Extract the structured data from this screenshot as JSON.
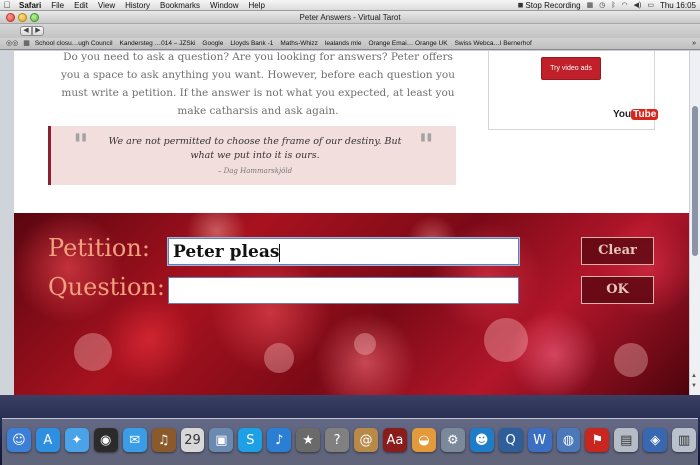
{
  "menubar": {
    "apple": "",
    "items": [
      "Safari",
      "File",
      "Edit",
      "View",
      "History",
      "Bookmarks",
      "Window",
      "Help"
    ],
    "stop_recording": "Stop Recording",
    "clock": "Thu 16:05"
  },
  "window": {
    "title": "Peter Answers - Virtual Tarot"
  },
  "bookmarks": [
    "School closu…ugh Council",
    "Kandersteg …014 – JZSki",
    "Google",
    "Lloyds Bank -1",
    "Maths-Whizz",
    "lealands mle",
    "Orange Emai… Orange UK",
    "Swiss Webca…l Bernerhof"
  ],
  "page": {
    "intro": "Do you need to ask a question? Are you looking for answers? Peter offers you a space to ask anything you want. However, before each question you must write a petition. If the answer is not what you expected, at least you make catharsis and ask again.",
    "quote": {
      "text": "We are not permitted to choose the frame of our destiny. But what we put into it is ours.",
      "author": "– Dag Hammarskjöld"
    },
    "ad": {
      "button": "Try video ads",
      "logo_you": "You",
      "logo_tube": "Tube"
    },
    "form": {
      "petition_label": "Petition:",
      "question_label": "Question:",
      "petition_value": "Peter pleas",
      "question_value": "",
      "clear_button": "Clear",
      "ok_button": "OK"
    }
  },
  "dock": [
    {
      "name": "finder-icon",
      "glyph": "☺",
      "color": "#3c7fd6"
    },
    {
      "name": "app-store-icon",
      "glyph": "A",
      "color": "#2e8fe0"
    },
    {
      "name": "safari-icon",
      "glyph": "✦",
      "color": "#4aa3e8"
    },
    {
      "name": "dashboard-icon",
      "glyph": "◉",
      "color": "#2b2b2b"
    },
    {
      "name": "ichat-icon",
      "glyph": "✉",
      "color": "#3a9de6"
    },
    {
      "name": "garageband-icon",
      "glyph": "♫",
      "color": "#8a5a2b"
    },
    {
      "name": "ical-icon",
      "glyph": "29",
      "color": "#d8d8d8"
    },
    {
      "name": "iphoto-icon",
      "glyph": "▣",
      "color": "#6b8ab0"
    },
    {
      "name": "skype-icon",
      "glyph": "S",
      "color": "#1ea0e6"
    },
    {
      "name": "itunes-icon",
      "glyph": "♪",
      "color": "#2a7fd4"
    },
    {
      "name": "imovie-icon",
      "glyph": "★",
      "color": "#6a6a6a"
    },
    {
      "name": "help-icon",
      "glyph": "?",
      "color": "#808080"
    },
    {
      "name": "address-book-icon",
      "glyph": "@",
      "color": "#b88a4a"
    },
    {
      "name": "dictionary-icon",
      "glyph": "Aa",
      "color": "#8b1c1c"
    },
    {
      "name": "preview-icon",
      "glyph": "◒",
      "color": "#e39a3b"
    },
    {
      "name": "system-preferences-icon",
      "glyph": "⚙",
      "color": "#7b8a9a"
    },
    {
      "name": "messenger-icon",
      "glyph": "☻",
      "color": "#1e7cc9"
    },
    {
      "name": "quicktime-icon",
      "glyph": "Q",
      "color": "#2f5f9a"
    },
    {
      "name": "word-icon",
      "glyph": "W",
      "color": "#3b6fc4"
    },
    {
      "name": "network-icon",
      "glyph": "◍",
      "color": "#4a78b8"
    },
    {
      "name": "acrobat-icon",
      "glyph": "⚑",
      "color": "#c8261e"
    },
    {
      "name": "utility-icon",
      "glyph": "▤",
      "color": "#b5bcc6"
    },
    {
      "name": "preferences-icon",
      "glyph": "◈",
      "color": "#3a68b0"
    },
    {
      "name": "trash-icon",
      "glyph": "▥",
      "color": "#b9c1cc"
    }
  ]
}
